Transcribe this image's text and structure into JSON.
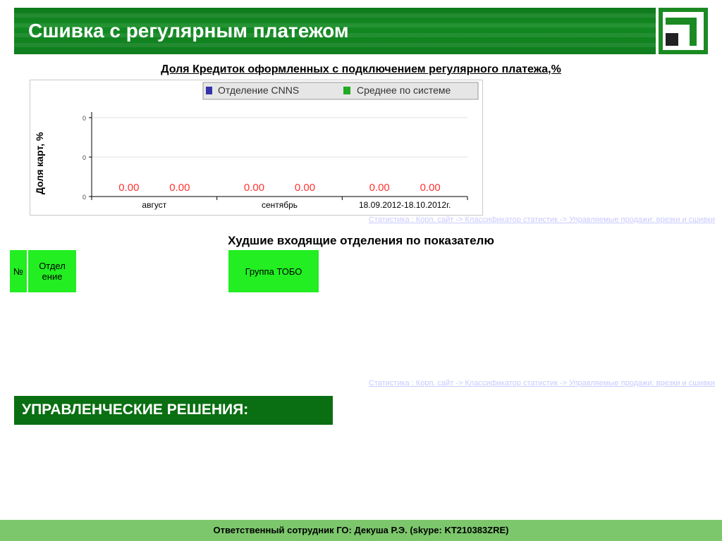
{
  "header": {
    "title": "Сшивка с регулярным платежом"
  },
  "chart_title": "Доля Кредиток оформленных с подключением регулярного платежа,%",
  "chart_data": {
    "type": "bar",
    "categories": [
      "август",
      "сентябрь",
      "18.09.2012-18.10.2012г."
    ],
    "series": [
      {
        "name": "Отделение CNNS",
        "values": [
          0.0,
          0.0,
          0.0
        ],
        "value_labels": [
          "0.00",
          "0.00",
          "0.00"
        ],
        "color": "#3333aa"
      },
      {
        "name": "Среднее по системе",
        "values": [
          0.0,
          0.0,
          0.0
        ],
        "value_labels": [
          "0.00",
          "0.00",
          "0.00"
        ],
        "color": "#22aa22"
      }
    ],
    "ylabel": "Доля карт, %",
    "ytick_labels": [
      "0",
      "0",
      "0"
    ],
    "ylim": [
      0,
      1
    ],
    "grid": true,
    "legend_position": "top-right",
    "data_label_color": "#ff3333"
  },
  "source_link": "Статистика : Корп. сайт -> Классификатор статистик -> Управляемые продажи: врезки и сшивки",
  "worst_title": "Худшие входящие отделения по показателю",
  "table": {
    "col_no": "№",
    "col_department": "Отдел ение",
    "col_group": "Группа ТОБО"
  },
  "decisions_label": "УПРАВЛЕНЧЕСКИЕ РЕШЕНИЯ:",
  "footer": {
    "text": "Ответственный сотрудник ГО: Декуша Р.Э. (skype: KT210383ZRE)"
  }
}
